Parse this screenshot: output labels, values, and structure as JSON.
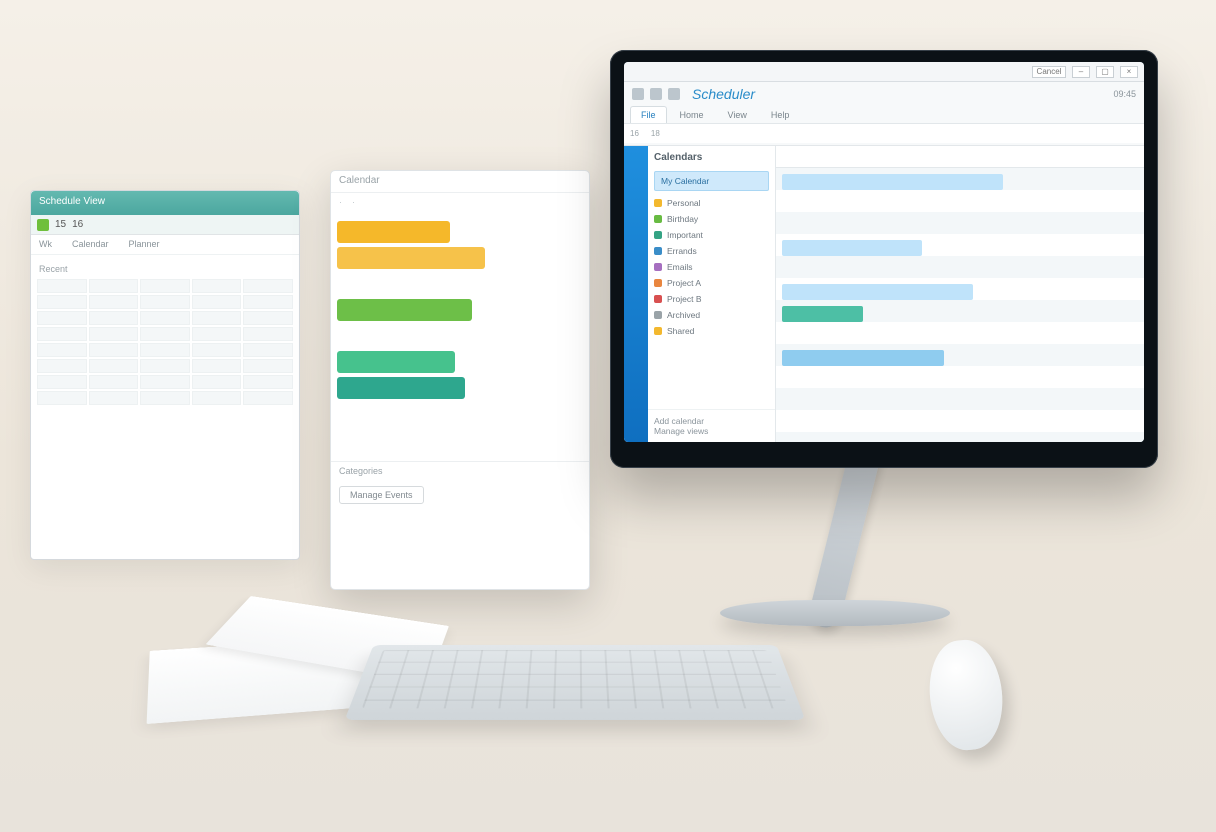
{
  "panel_left": {
    "title": "Schedule View",
    "btn1": "15",
    "btn2": "16",
    "tab1": "Wk",
    "tab2": "Calendar",
    "tab3": "Planner",
    "section": "Recent"
  },
  "panel_mid": {
    "title": "Calendar",
    "foot_label": "Categories",
    "foot_btn": "Manage Events"
  },
  "os": {
    "win_label": "Cancel"
  },
  "app": {
    "brand": "Scheduler",
    "tabs": [
      "File",
      "Home",
      "View",
      "Help"
    ],
    "header_right": "09:45",
    "ribbon_num1": "16",
    "ribbon_num2": "18"
  },
  "sidebar": {
    "section": "Calendars",
    "highlight": "My Calendar",
    "items": [
      {
        "label": "Personal"
      },
      {
        "label": "Birthday"
      },
      {
        "label": "Important"
      },
      {
        "label": "Errands"
      },
      {
        "label": "Emails"
      },
      {
        "label": "Project A"
      },
      {
        "label": "Project B"
      },
      {
        "label": "Archived"
      },
      {
        "label": "Shared"
      }
    ],
    "footer1": "Add calendar",
    "footer2": "Manage views"
  }
}
